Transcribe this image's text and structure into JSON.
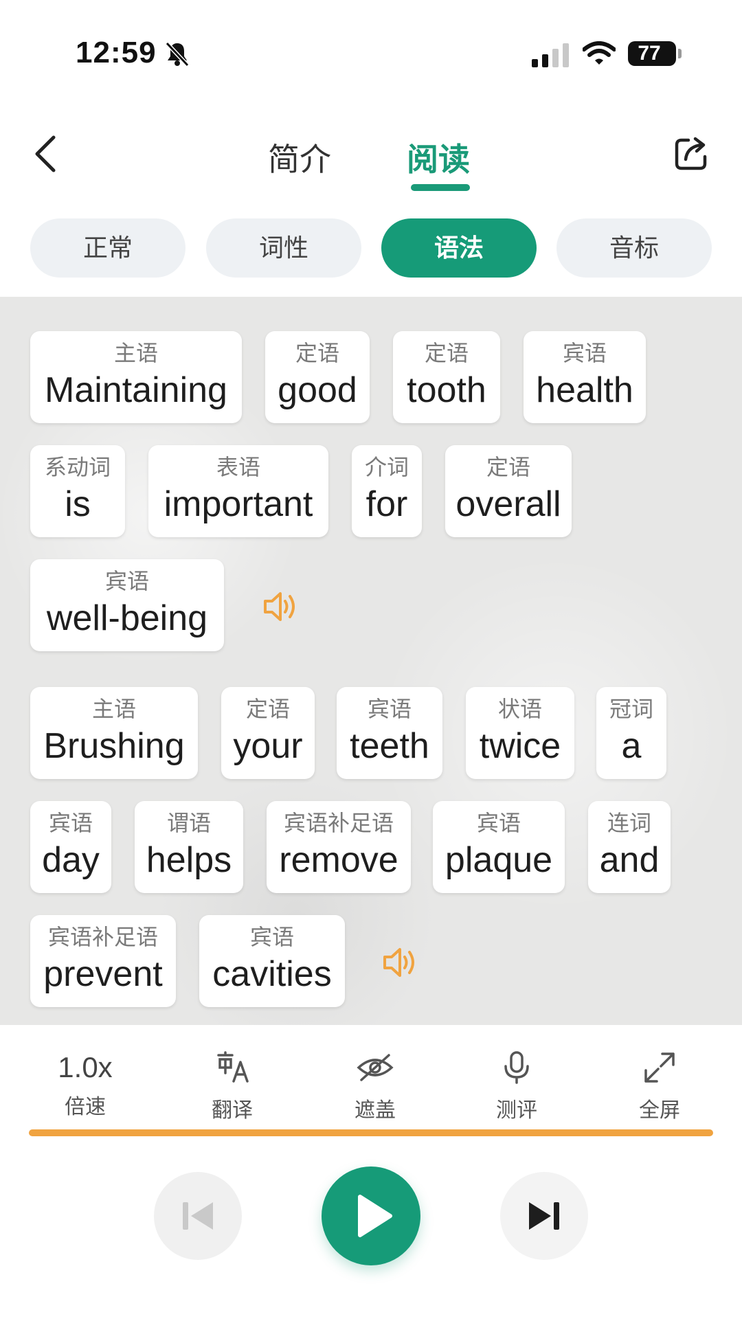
{
  "status_bar": {
    "time": "12:59",
    "battery": "77"
  },
  "header": {
    "tabs": [
      {
        "label": "简介"
      },
      {
        "label": "阅读"
      }
    ],
    "active_tab": "阅读"
  },
  "modes": [
    {
      "label": "正常"
    },
    {
      "label": "词性"
    },
    {
      "label": "语法"
    },
    {
      "label": "音标"
    }
  ],
  "active_mode": "语法",
  "sentences": [
    {
      "words": [
        {
          "label": "主语",
          "word": "Maintaining"
        },
        {
          "label": "定语",
          "word": "good"
        },
        {
          "label": "定语",
          "word": "tooth"
        },
        {
          "label": "宾语",
          "word": "health"
        },
        {
          "label": "系动词",
          "word": "is"
        },
        {
          "label": "表语",
          "word": "important"
        },
        {
          "label": "介词",
          "word": "for"
        },
        {
          "label": "定语",
          "word": "overall"
        },
        {
          "label": "宾语",
          "word": "well-being"
        }
      ]
    },
    {
      "words": [
        {
          "label": "主语",
          "word": "Brushing"
        },
        {
          "label": "定语",
          "word": "your"
        },
        {
          "label": "宾语",
          "word": "teeth"
        },
        {
          "label": "状语",
          "word": "twice"
        },
        {
          "label": "冠词",
          "word": "a"
        },
        {
          "label": "宾语",
          "word": "day"
        },
        {
          "label": "谓语",
          "word": "helps"
        },
        {
          "label": "宾语补足语",
          "word": "remove"
        },
        {
          "label": "宾语",
          "word": "plaque"
        },
        {
          "label": "连词",
          "word": "and"
        },
        {
          "label": "宾语补足语",
          "word": "prevent"
        },
        {
          "label": "宾语",
          "word": "cavities"
        }
      ]
    }
  ],
  "toolbar": {
    "speed": {
      "value": "1.0x",
      "label": "倍速"
    },
    "translate": {
      "label": "翻译"
    },
    "cover": {
      "label": "遮盖"
    },
    "evaluate": {
      "label": "测评"
    },
    "fullscreen": {
      "label": "全屏"
    }
  },
  "playback": {
    "progress": 1.0
  },
  "colors": {
    "accent": "#169b78",
    "audio": "#f0a340",
    "progress": "#f0a340"
  }
}
